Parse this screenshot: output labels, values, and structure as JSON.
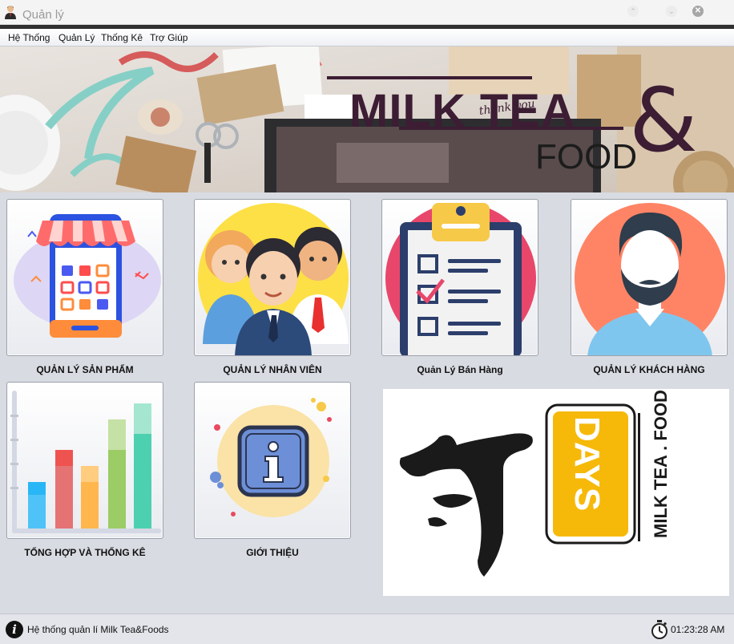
{
  "window": {
    "title": "Quản lý"
  },
  "menu": [
    "Hệ Thống",
    "Quản Lý",
    "Thống Kê",
    "Trợ Giúp"
  ],
  "banner": {
    "brand_line1": "MILK TEA",
    "brand_line2": "FOOD",
    "ampersand": "&",
    "note": "thank you"
  },
  "tiles": [
    {
      "label": "QUẢN LÝ SẢN PHẨM",
      "icon": "store-phone-icon"
    },
    {
      "label": "QUẢN LÝ NHÂN VIÊN",
      "icon": "staff-group-icon"
    },
    {
      "label": "Quản Lý Bán Hàng",
      "icon": "clipboard-checklist-icon"
    },
    {
      "label": "QUẢN LÝ KHÁCH HÀNG",
      "icon": "customer-avatar-icon"
    },
    {
      "label": "TỔNG HỢP VÀ THỐNG KÊ",
      "icon": "bar-chart-icon"
    },
    {
      "label": "GIỚI THIỆU",
      "icon": "info-icon"
    }
  ],
  "logo": {
    "word": "DAYS",
    "tagline": "MILK TEA . FOOD"
  },
  "status": {
    "text": "Hệ thống quản lí Milk Tea&Foods",
    "time": "01:23:28 AM"
  }
}
